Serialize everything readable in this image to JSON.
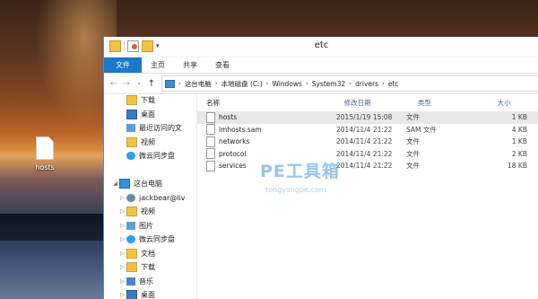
{
  "desktop": {
    "icon_label": "hosts"
  },
  "window": {
    "title": "etc",
    "ribbon_tabs": [
      "文件",
      "主页",
      "共享",
      "查看"
    ],
    "address": {
      "segments": [
        "这台电脑",
        "本地磁盘 (C:)",
        "Windows",
        "System32",
        "drivers",
        "etc"
      ]
    }
  },
  "nav": {
    "items": [
      {
        "label": "下载",
        "icon": "folder-download-icon",
        "indent": 1
      },
      {
        "label": "桌面",
        "icon": "desktop-icon",
        "indent": 1
      },
      {
        "label": "最近访问的文",
        "icon": "recent-icon",
        "indent": 1
      },
      {
        "label": "视频",
        "icon": "video-folder-icon",
        "indent": 1
      },
      {
        "label": "微云同步盘",
        "icon": "cloud-icon",
        "indent": 1
      },
      {
        "label": "",
        "icon": "",
        "indent": 0
      },
      {
        "label": "这台电脑",
        "icon": "computer-icon",
        "indent": 0,
        "expand": "◢"
      },
      {
        "label": "jackbear@liv",
        "icon": "user-icon",
        "indent": 1,
        "expand": "▷"
      },
      {
        "label": "视频",
        "icon": "video-folder-icon",
        "indent": 1,
        "expand": "▷"
      },
      {
        "label": "图片",
        "icon": "pictures-folder-icon",
        "indent": 1,
        "expand": "▷"
      },
      {
        "label": "微云同步盘",
        "icon": "cloud-icon",
        "indent": 1,
        "expand": "▷"
      },
      {
        "label": "文档",
        "icon": "documents-folder-icon",
        "indent": 1,
        "expand": "▷"
      },
      {
        "label": "下载",
        "icon": "folder-download-icon",
        "indent": 1,
        "expand": "▷"
      },
      {
        "label": "音乐",
        "icon": "music-folder-icon",
        "indent": 1,
        "expand": "▷"
      },
      {
        "label": "桌面",
        "icon": "desktop-icon",
        "indent": 1,
        "expand": "▷"
      }
    ]
  },
  "list": {
    "columns": [
      "名称",
      "修改日期",
      "类型",
      "大小"
    ],
    "rows": [
      {
        "name": "hosts",
        "date": "2015/1/19 15:08",
        "type": "文件",
        "size": "1 KB",
        "selected": true
      },
      {
        "name": "lmhosts.sam",
        "date": "2014/11/4 21:22",
        "type": "SAM 文件",
        "size": "4 KB",
        "selected": false
      },
      {
        "name": "networks",
        "date": "2014/11/4 21:22",
        "type": "文件",
        "size": "1 KB",
        "selected": false
      },
      {
        "name": "protocol",
        "date": "2014/11/4 21:22",
        "type": "文件",
        "size": "2 KB",
        "selected": false
      },
      {
        "name": "services",
        "date": "2014/11/4 21:22",
        "type": "文件",
        "size": "18 KB",
        "selected": false
      }
    ]
  },
  "watermark": {
    "main": "PE工具箱",
    "sub": "tongyongpe.com"
  }
}
